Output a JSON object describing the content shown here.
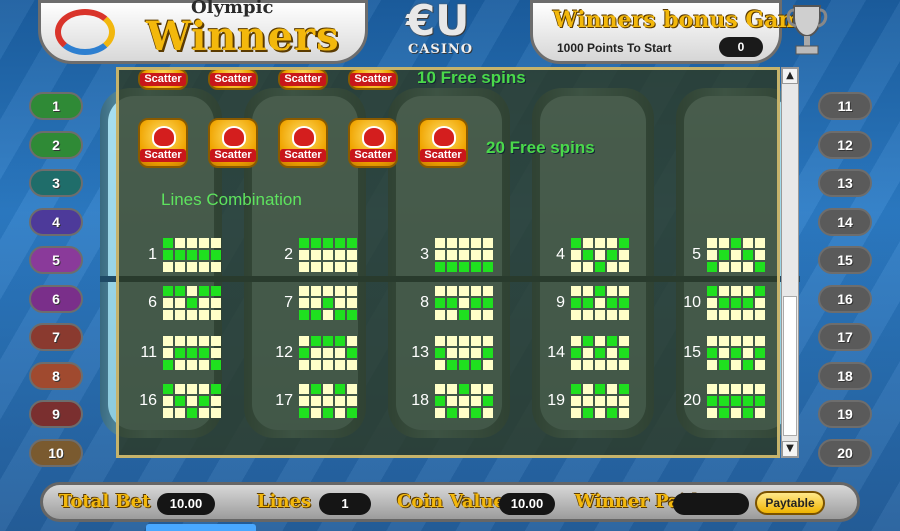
{
  "header": {
    "logo_small_text": "Olympic",
    "logo_title": "Winners",
    "casino_logo": "€U",
    "casino_word": "CASINO",
    "bonus_title": "Winners bonus Game",
    "bonus_subtitle": "1000 Points To Start",
    "bonus_value": "0",
    "trophy_icon": "trophy-icon"
  },
  "left_lines": [
    "1",
    "2",
    "3",
    "4",
    "5",
    "6",
    "7",
    "8",
    "9",
    "10"
  ],
  "right_lines": [
    "11",
    "12",
    "13",
    "14",
    "15",
    "16",
    "17",
    "18",
    "19",
    "20"
  ],
  "left_line_colors": [
    "#2f8a36",
    "#2f8a36",
    "#1f6d6a",
    "#4d3a9a",
    "#8a3a9a",
    "#7a2f8a",
    "#8a3a2f",
    "#a04a2f",
    "#7a2f2f",
    "#7a5a2f"
  ],
  "paytable": {
    "scatter_label": "Scatter",
    "free_spins_10": "10 Free spins",
    "free_spins_20": "20 Free spins",
    "lines_title": "Lines Combination",
    "combos": [
      {
        "n": "1",
        "on": [
          [
            1,
            0,
            0,
            0,
            0
          ],
          [
            1,
            1,
            1,
            1,
            1
          ],
          [
            0,
            0,
            0,
            0,
            0
          ]
        ]
      },
      {
        "n": "2",
        "on": [
          [
            1,
            1,
            1,
            1,
            1
          ],
          [
            0,
            0,
            0,
            0,
            0
          ],
          [
            0,
            0,
            0,
            0,
            0
          ]
        ]
      },
      {
        "n": "3",
        "on": [
          [
            0,
            0,
            0,
            0,
            0
          ],
          [
            0,
            0,
            0,
            0,
            0
          ],
          [
            1,
            1,
            1,
            1,
            1
          ]
        ]
      },
      {
        "n": "4",
        "on": [
          [
            1,
            0,
            0,
            0,
            1
          ],
          [
            0,
            1,
            0,
            1,
            0
          ],
          [
            0,
            0,
            1,
            0,
            0
          ]
        ]
      },
      {
        "n": "5",
        "on": [
          [
            0,
            0,
            1,
            0,
            0
          ],
          [
            0,
            1,
            0,
            1,
            0
          ],
          [
            1,
            0,
            0,
            0,
            1
          ]
        ]
      },
      {
        "n": "6",
        "on": [
          [
            1,
            1,
            0,
            1,
            1
          ],
          [
            0,
            0,
            1,
            0,
            0
          ],
          [
            0,
            0,
            0,
            0,
            0
          ]
        ]
      },
      {
        "n": "7",
        "on": [
          [
            0,
            0,
            0,
            0,
            0
          ],
          [
            0,
            0,
            1,
            0,
            0
          ],
          [
            1,
            1,
            0,
            1,
            1
          ]
        ]
      },
      {
        "n": "8",
        "on": [
          [
            0,
            0,
            0,
            0,
            0
          ],
          [
            1,
            1,
            0,
            1,
            1
          ],
          [
            0,
            0,
            1,
            0,
            0
          ]
        ]
      },
      {
        "n": "9",
        "on": [
          [
            0,
            0,
            1,
            0,
            0
          ],
          [
            1,
            1,
            0,
            1,
            1
          ],
          [
            0,
            0,
            0,
            0,
            0
          ]
        ]
      },
      {
        "n": "10",
        "on": [
          [
            1,
            0,
            0,
            0,
            1
          ],
          [
            0,
            1,
            1,
            1,
            0
          ],
          [
            0,
            0,
            0,
            0,
            0
          ]
        ]
      },
      {
        "n": "11",
        "on": [
          [
            0,
            0,
            0,
            0,
            0
          ],
          [
            0,
            1,
            1,
            1,
            0
          ],
          [
            1,
            0,
            0,
            0,
            1
          ]
        ]
      },
      {
        "n": "12",
        "on": [
          [
            0,
            1,
            1,
            1,
            0
          ],
          [
            1,
            0,
            0,
            0,
            1
          ],
          [
            0,
            0,
            0,
            0,
            0
          ]
        ]
      },
      {
        "n": "13",
        "on": [
          [
            0,
            0,
            0,
            0,
            0
          ],
          [
            1,
            0,
            0,
            0,
            1
          ],
          [
            0,
            1,
            1,
            1,
            0
          ]
        ]
      },
      {
        "n": "14",
        "on": [
          [
            0,
            1,
            0,
            1,
            0
          ],
          [
            1,
            0,
            1,
            0,
            1
          ],
          [
            0,
            0,
            0,
            0,
            0
          ]
        ]
      },
      {
        "n": "15",
        "on": [
          [
            0,
            0,
            0,
            0,
            0
          ],
          [
            1,
            0,
            1,
            0,
            1
          ],
          [
            0,
            1,
            0,
            1,
            0
          ]
        ]
      },
      {
        "n": "16",
        "on": [
          [
            1,
            0,
            0,
            0,
            1
          ],
          [
            0,
            1,
            0,
            1,
            0
          ],
          [
            0,
            0,
            1,
            0,
            0
          ]
        ]
      },
      {
        "n": "17",
        "on": [
          [
            0,
            1,
            0,
            1,
            0
          ],
          [
            0,
            0,
            0,
            0,
            0
          ],
          [
            1,
            0,
            1,
            0,
            1
          ]
        ]
      },
      {
        "n": "18",
        "on": [
          [
            0,
            0,
            1,
            0,
            0
          ],
          [
            1,
            0,
            0,
            0,
            1
          ],
          [
            0,
            1,
            0,
            1,
            0
          ]
        ]
      },
      {
        "n": "19",
        "on": [
          [
            1,
            0,
            1,
            0,
            1
          ],
          [
            0,
            0,
            0,
            0,
            0
          ],
          [
            0,
            1,
            0,
            1,
            0
          ]
        ]
      },
      {
        "n": "20",
        "on": [
          [
            0,
            0,
            0,
            0,
            0
          ],
          [
            1,
            1,
            1,
            1,
            1
          ],
          [
            0,
            1,
            0,
            1,
            0
          ]
        ]
      }
    ]
  },
  "scrollbar": {
    "up": "▲",
    "down": "▼"
  },
  "bottom": {
    "total_bet_label": "Total Bet",
    "total_bet_value": "10.00",
    "lines_label": "Lines",
    "lines_value": "1",
    "coin_value_label": "Coin Value",
    "coin_value_value": "10.00",
    "winner_paid_label": "Winner Paid",
    "winner_paid_value": "",
    "paytable_button": "Paytable"
  },
  "side_id": "57865083"
}
